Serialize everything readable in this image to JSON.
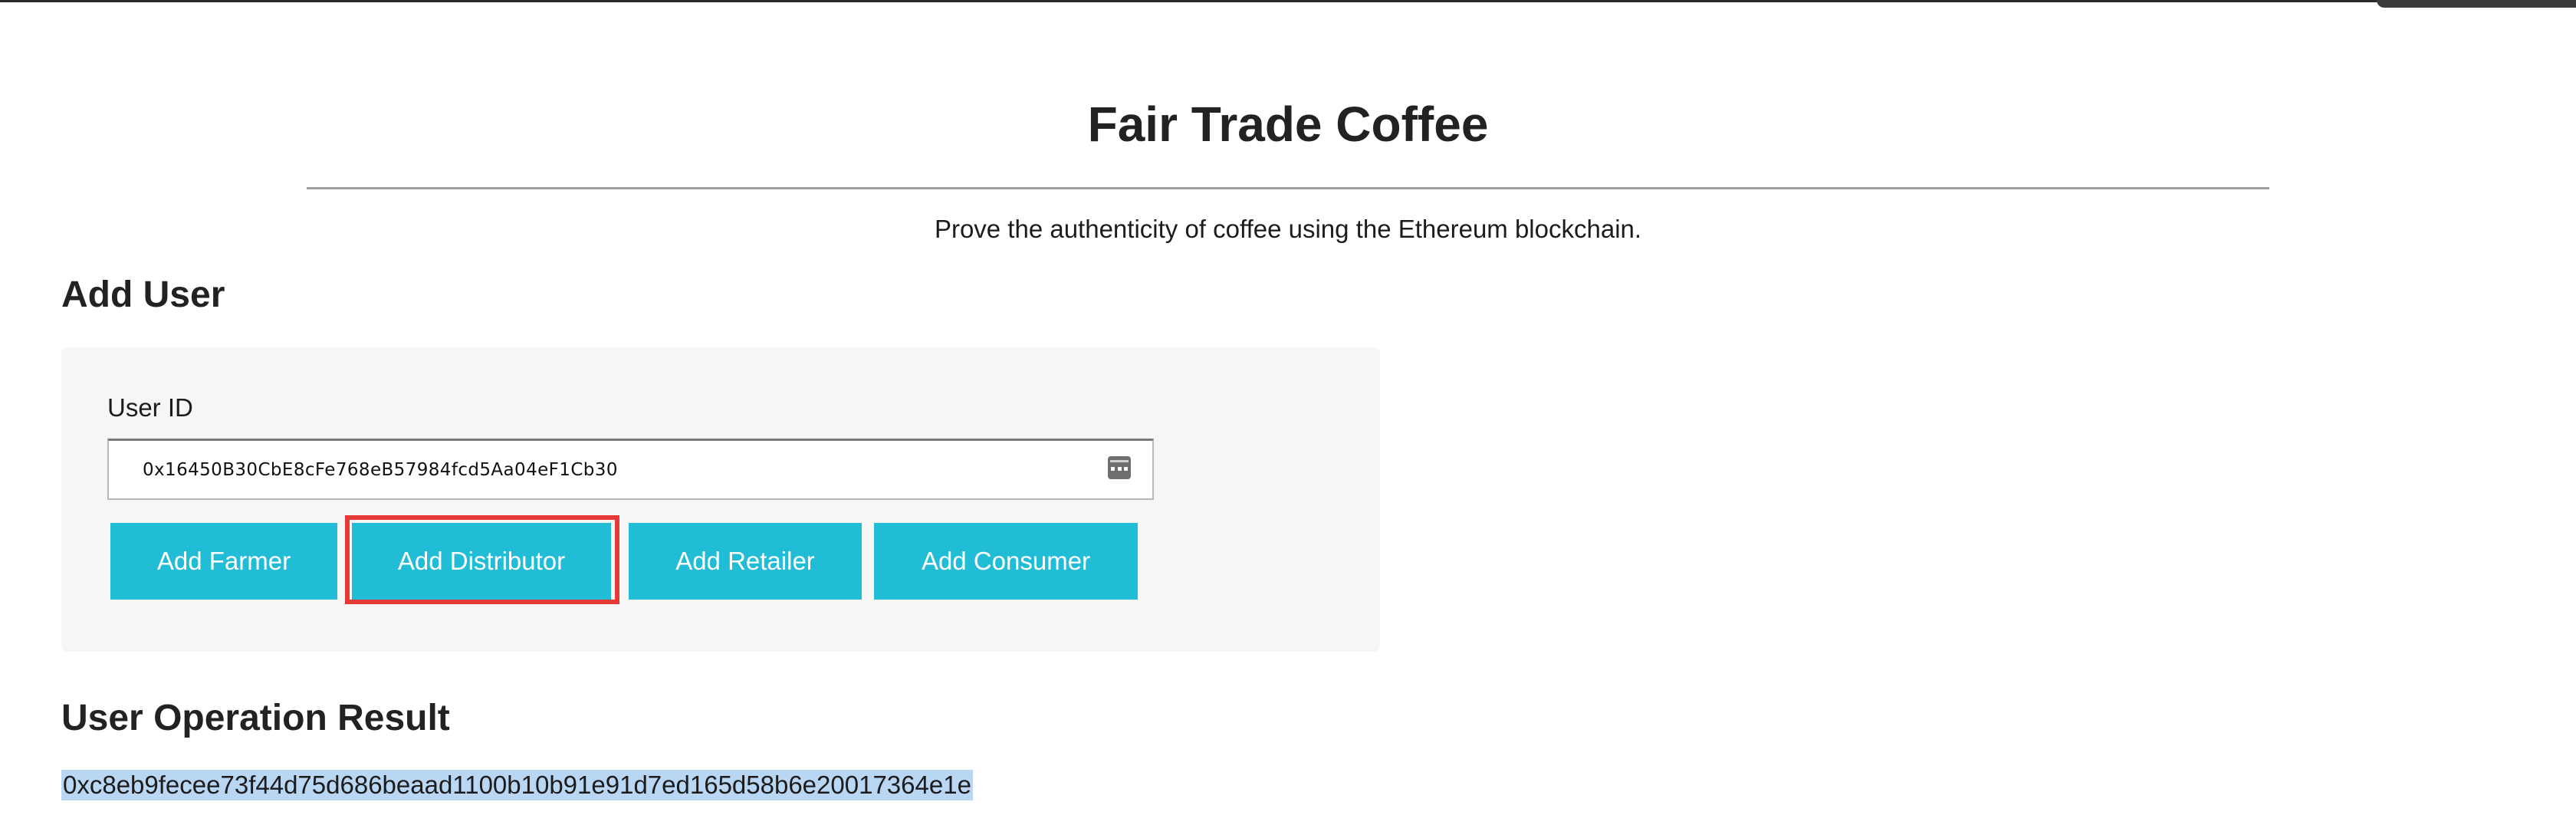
{
  "app": {
    "title": "Fair Trade Coffee",
    "subtitle": "Prove the authenticity of coffee using the Ethereum blockchain."
  },
  "add_user": {
    "heading": "Add User",
    "field_label": "User ID",
    "user_id_value": "0x16450B30CbE8cFe768eB57984fcd5Aa04eF1Cb30",
    "buttons": {
      "add_farmer": "Add Farmer",
      "add_distributor": "Add Distributor",
      "add_retailer": "Add Retailer",
      "add_consumer": "Add Consumer"
    }
  },
  "result": {
    "heading": "User Operation Result",
    "value": "0xc8eb9fecee73f44d75d686beaad1100b10b91e91d7ed165d58b6e20017364e1e"
  },
  "colors": {
    "button": "#21bcd5",
    "highlight": "#e53935",
    "selection": "#b9d6f3"
  },
  "icons": {
    "input_icon": "contact-card-icon"
  }
}
